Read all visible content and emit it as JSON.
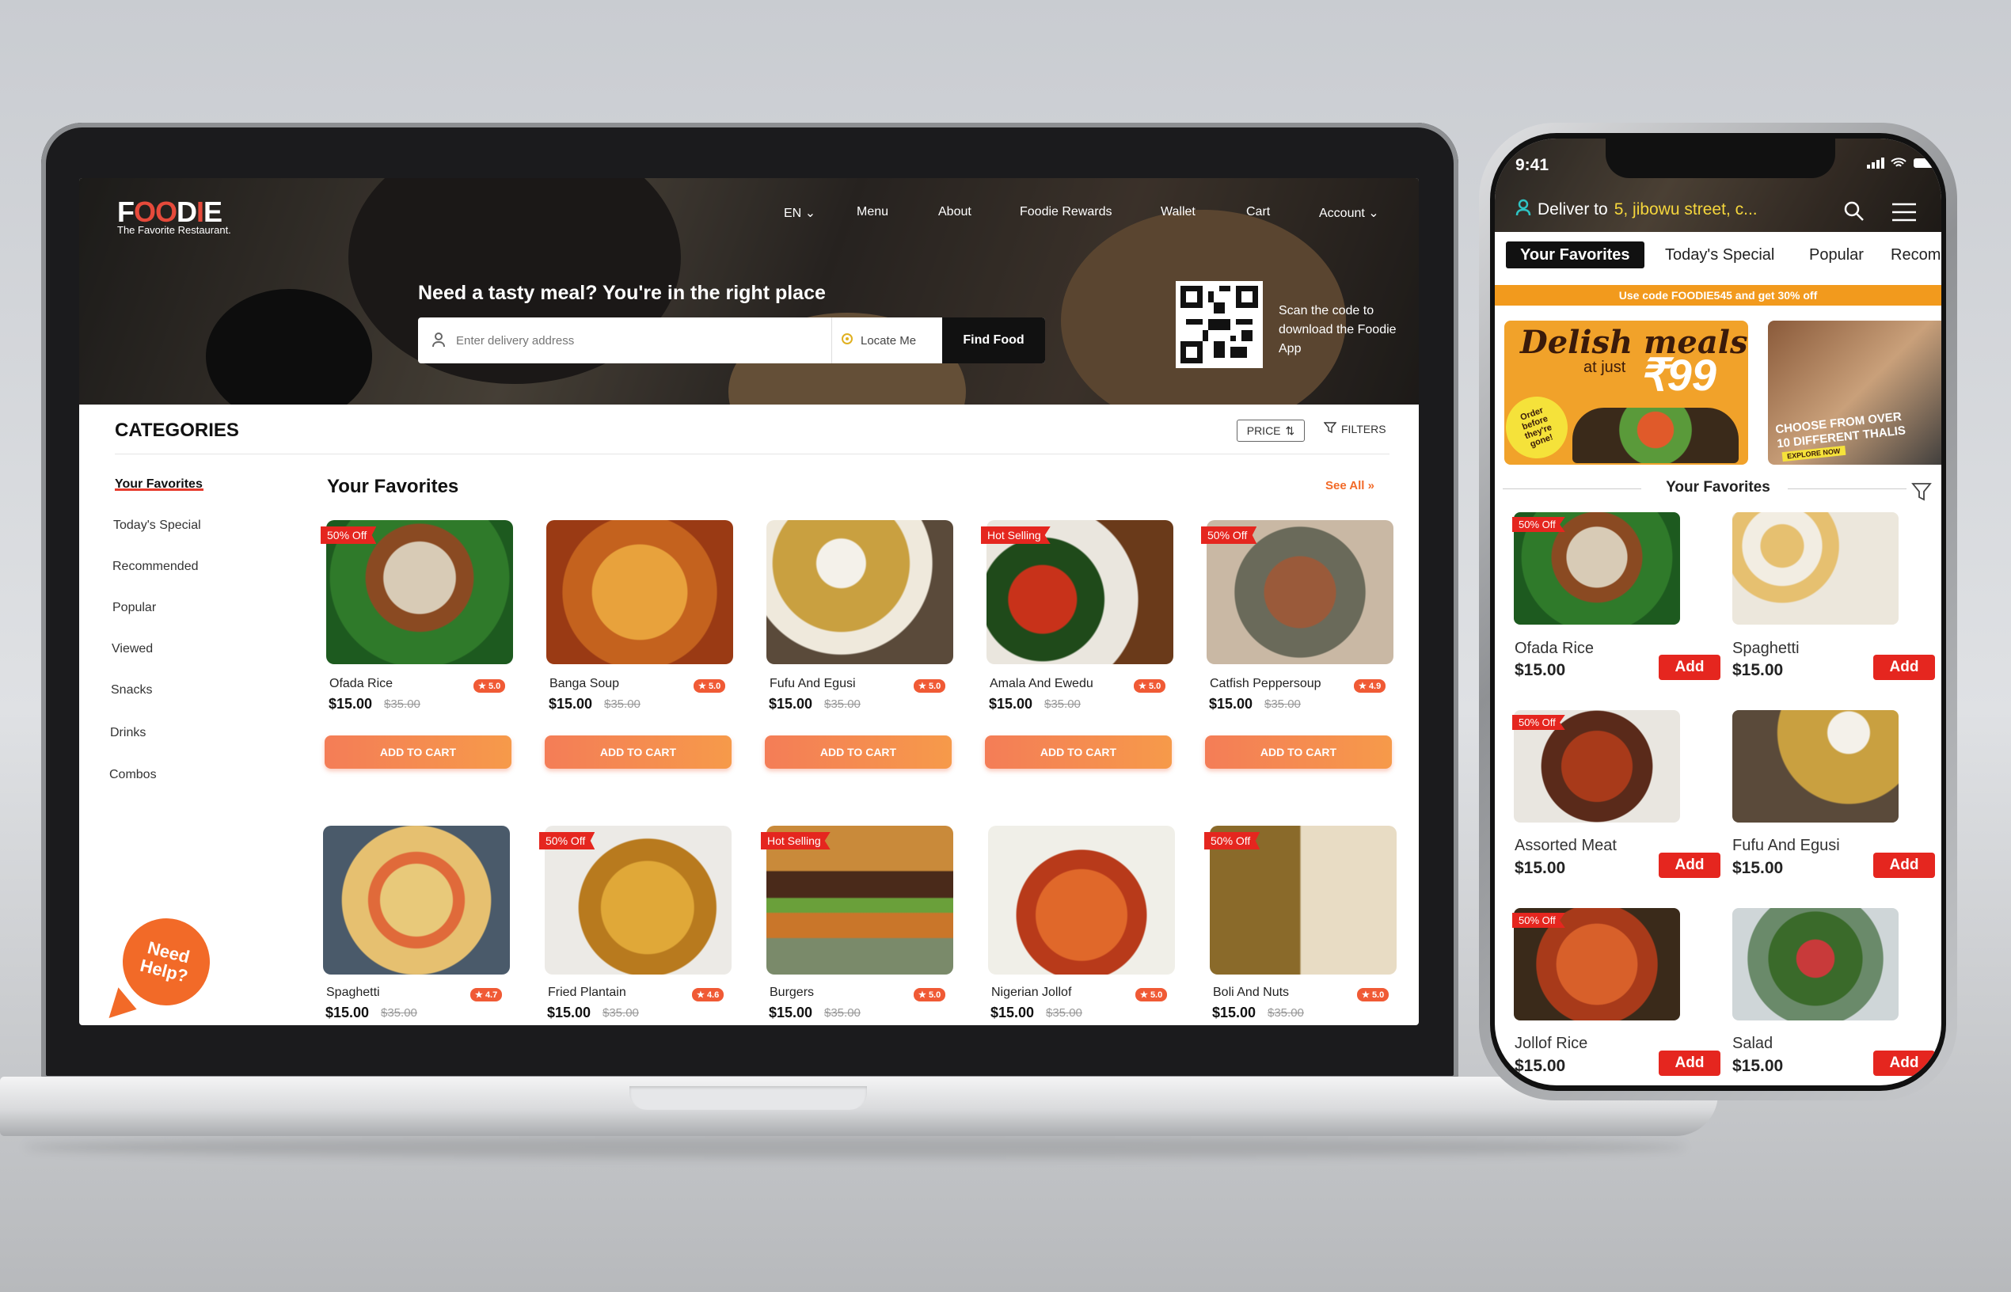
{
  "laptop": {
    "logo": {
      "text_a": "F",
      "text_o1": "O",
      "text_o2": "O",
      "text_b": "D",
      "text_i": "I",
      "text_e": "E",
      "tagline": "The Favorite Restaurant."
    },
    "nav": [
      "EN",
      "Menu",
      "About",
      "Foodie Rewards",
      "Wallet",
      "Cart",
      "Account"
    ],
    "hero_title": "Need a tasty meal? You're in the right place",
    "search": {
      "placeholder": "Enter delivery address",
      "locate_label": "Locate Me",
      "find_label": "Find Food"
    },
    "qr_text": "Scan the code to download the Foodie App",
    "categories_title": "CATEGORIES",
    "price_label": "PRICE",
    "filters_label": "FILTERS",
    "categories": [
      "Your Favorites",
      "Today's Special",
      "Recommended",
      "Popular",
      "Viewed",
      "Snacks",
      "Drinks",
      "Combos"
    ],
    "section_title": "Your Favorites",
    "see_all": "See All",
    "add_to_cart": "ADD TO CART",
    "need_help": "Need Help?",
    "items_row1": [
      {
        "name": "Ofada Rice",
        "price": "$15.00",
        "old": "$35.00",
        "rating": "5.0",
        "badge": "50% Off"
      },
      {
        "name": "Banga Soup",
        "price": "$15.00",
        "old": "$35.00",
        "rating": "5.0",
        "badge": ""
      },
      {
        "name": "Fufu And Egusi",
        "price": "$15.00",
        "old": "$35.00",
        "rating": "5.0",
        "badge": ""
      },
      {
        "name": "Amala And Ewedu",
        "price": "$15.00",
        "old": "$35.00",
        "rating": "5.0",
        "badge": "Hot Selling"
      },
      {
        "name": "Catfish Peppersoup",
        "price": "$15.00",
        "old": "$35.00",
        "rating": "4.9",
        "badge": "50% Off"
      }
    ],
    "items_row2": [
      {
        "name": "Spaghetti",
        "price": "$15.00",
        "old": "$35.00",
        "rating": "4.7",
        "badge": ""
      },
      {
        "name": "Fried Plantain",
        "price": "$15.00",
        "old": "$35.00",
        "rating": "4.6",
        "badge": "50% Off"
      },
      {
        "name": "Burgers",
        "price": "$15.00",
        "old": "$35.00",
        "rating": "5.0",
        "badge": "Hot Selling"
      },
      {
        "name": "Nigerian Jollof",
        "price": "$15.00",
        "old": "$35.00",
        "rating": "5.0",
        "badge": ""
      },
      {
        "name": "Boli And Nuts",
        "price": "$15.00",
        "old": "$35.00",
        "rating": "5.0",
        "badge": "50% Off"
      }
    ]
  },
  "phone": {
    "time": "9:41",
    "deliver_label": "Deliver to",
    "address": "5, jibowu street, c...",
    "tabs": [
      "Your Favorites",
      "Today's Special",
      "Popular",
      "Recom"
    ],
    "promo": "Use code FOODIE545 and get 30% off",
    "banner1": {
      "title": "Delish meals",
      "sub": "at just",
      "price": "₹99",
      "sticker": "Order before they're gone!"
    },
    "banner2": {
      "title": "CHOOSE FROM OVER 10 DIFFERENT THALIS",
      "cta": "EXPLORE NOW"
    },
    "fav_title": "Your Favorites",
    "add_label": "Add",
    "items": [
      {
        "name": "Ofada Rice",
        "price": "$15.00",
        "badge": "50% Off"
      },
      {
        "name": "Spaghetti",
        "price": "$15.00",
        "badge": ""
      },
      {
        "name": "Assorted Meat",
        "price": "$15.00",
        "badge": "50% Off"
      },
      {
        "name": "Fufu And Egusi",
        "price": "$15.00",
        "badge": ""
      },
      {
        "name": "Jollof Rice",
        "price": "$15.00",
        "badge": "50% Off"
      },
      {
        "name": "Salad",
        "price": "$15.00",
        "badge": ""
      }
    ]
  },
  "colors": {
    "accent": "#e5261f",
    "orange": "#f26a28",
    "promo": "#f29a1d",
    "address": "#f5d63c"
  }
}
